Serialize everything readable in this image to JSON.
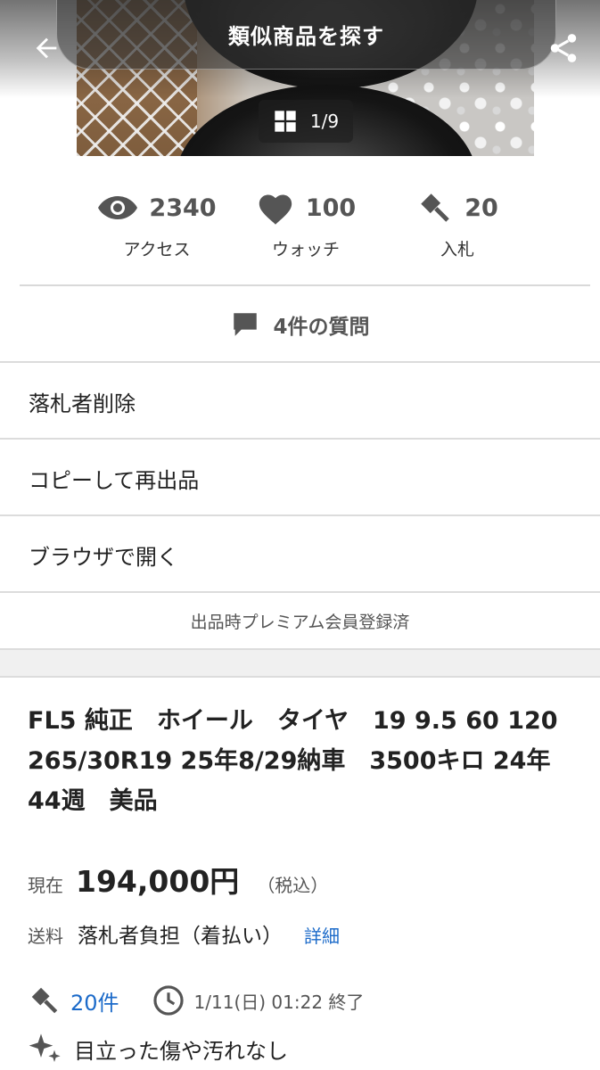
{
  "header": {
    "similar_button": "類似商品を探す",
    "image_counter": "1/9",
    "back_icon": "arrow-left-icon",
    "share_icon": "share-icon",
    "grid_icon": "grid-icon"
  },
  "stats": [
    {
      "icon": "eye-icon",
      "value": "2340",
      "label": "アクセス"
    },
    {
      "icon": "heart-icon",
      "value": "100",
      "label": "ウォッチ"
    },
    {
      "icon": "gavel-icon",
      "value": "20",
      "label": "入札"
    }
  ],
  "questions": {
    "label": "4件の質問",
    "icon": "speech-bubble-icon"
  },
  "menu": [
    {
      "label": "落札者削除"
    },
    {
      "label": "コピーして再出品"
    },
    {
      "label": "ブラウザで開く"
    }
  ],
  "premium_note": "出品時プレミアム会員登録済",
  "item": {
    "title": "FL5 純正　ホイール　タイヤ　19 9.5 60 120 265/30R19 25年8/29納車　3500キロ 24年44週　美品",
    "price_label": "現在",
    "price_value": "194,000円",
    "price_tax": "（税込）",
    "shipping_label": "送料",
    "shipping_value": "落札者負担（着払い）",
    "shipping_detail": "詳細",
    "bid_count": "20件",
    "end_time": "1/11(日) 01:22 終了",
    "condition": "目立った傷や汚れなし"
  },
  "colors": {
    "link": "#1b6ac9",
    "icon_gray": "#555555",
    "divider": "#dcdcdc"
  }
}
